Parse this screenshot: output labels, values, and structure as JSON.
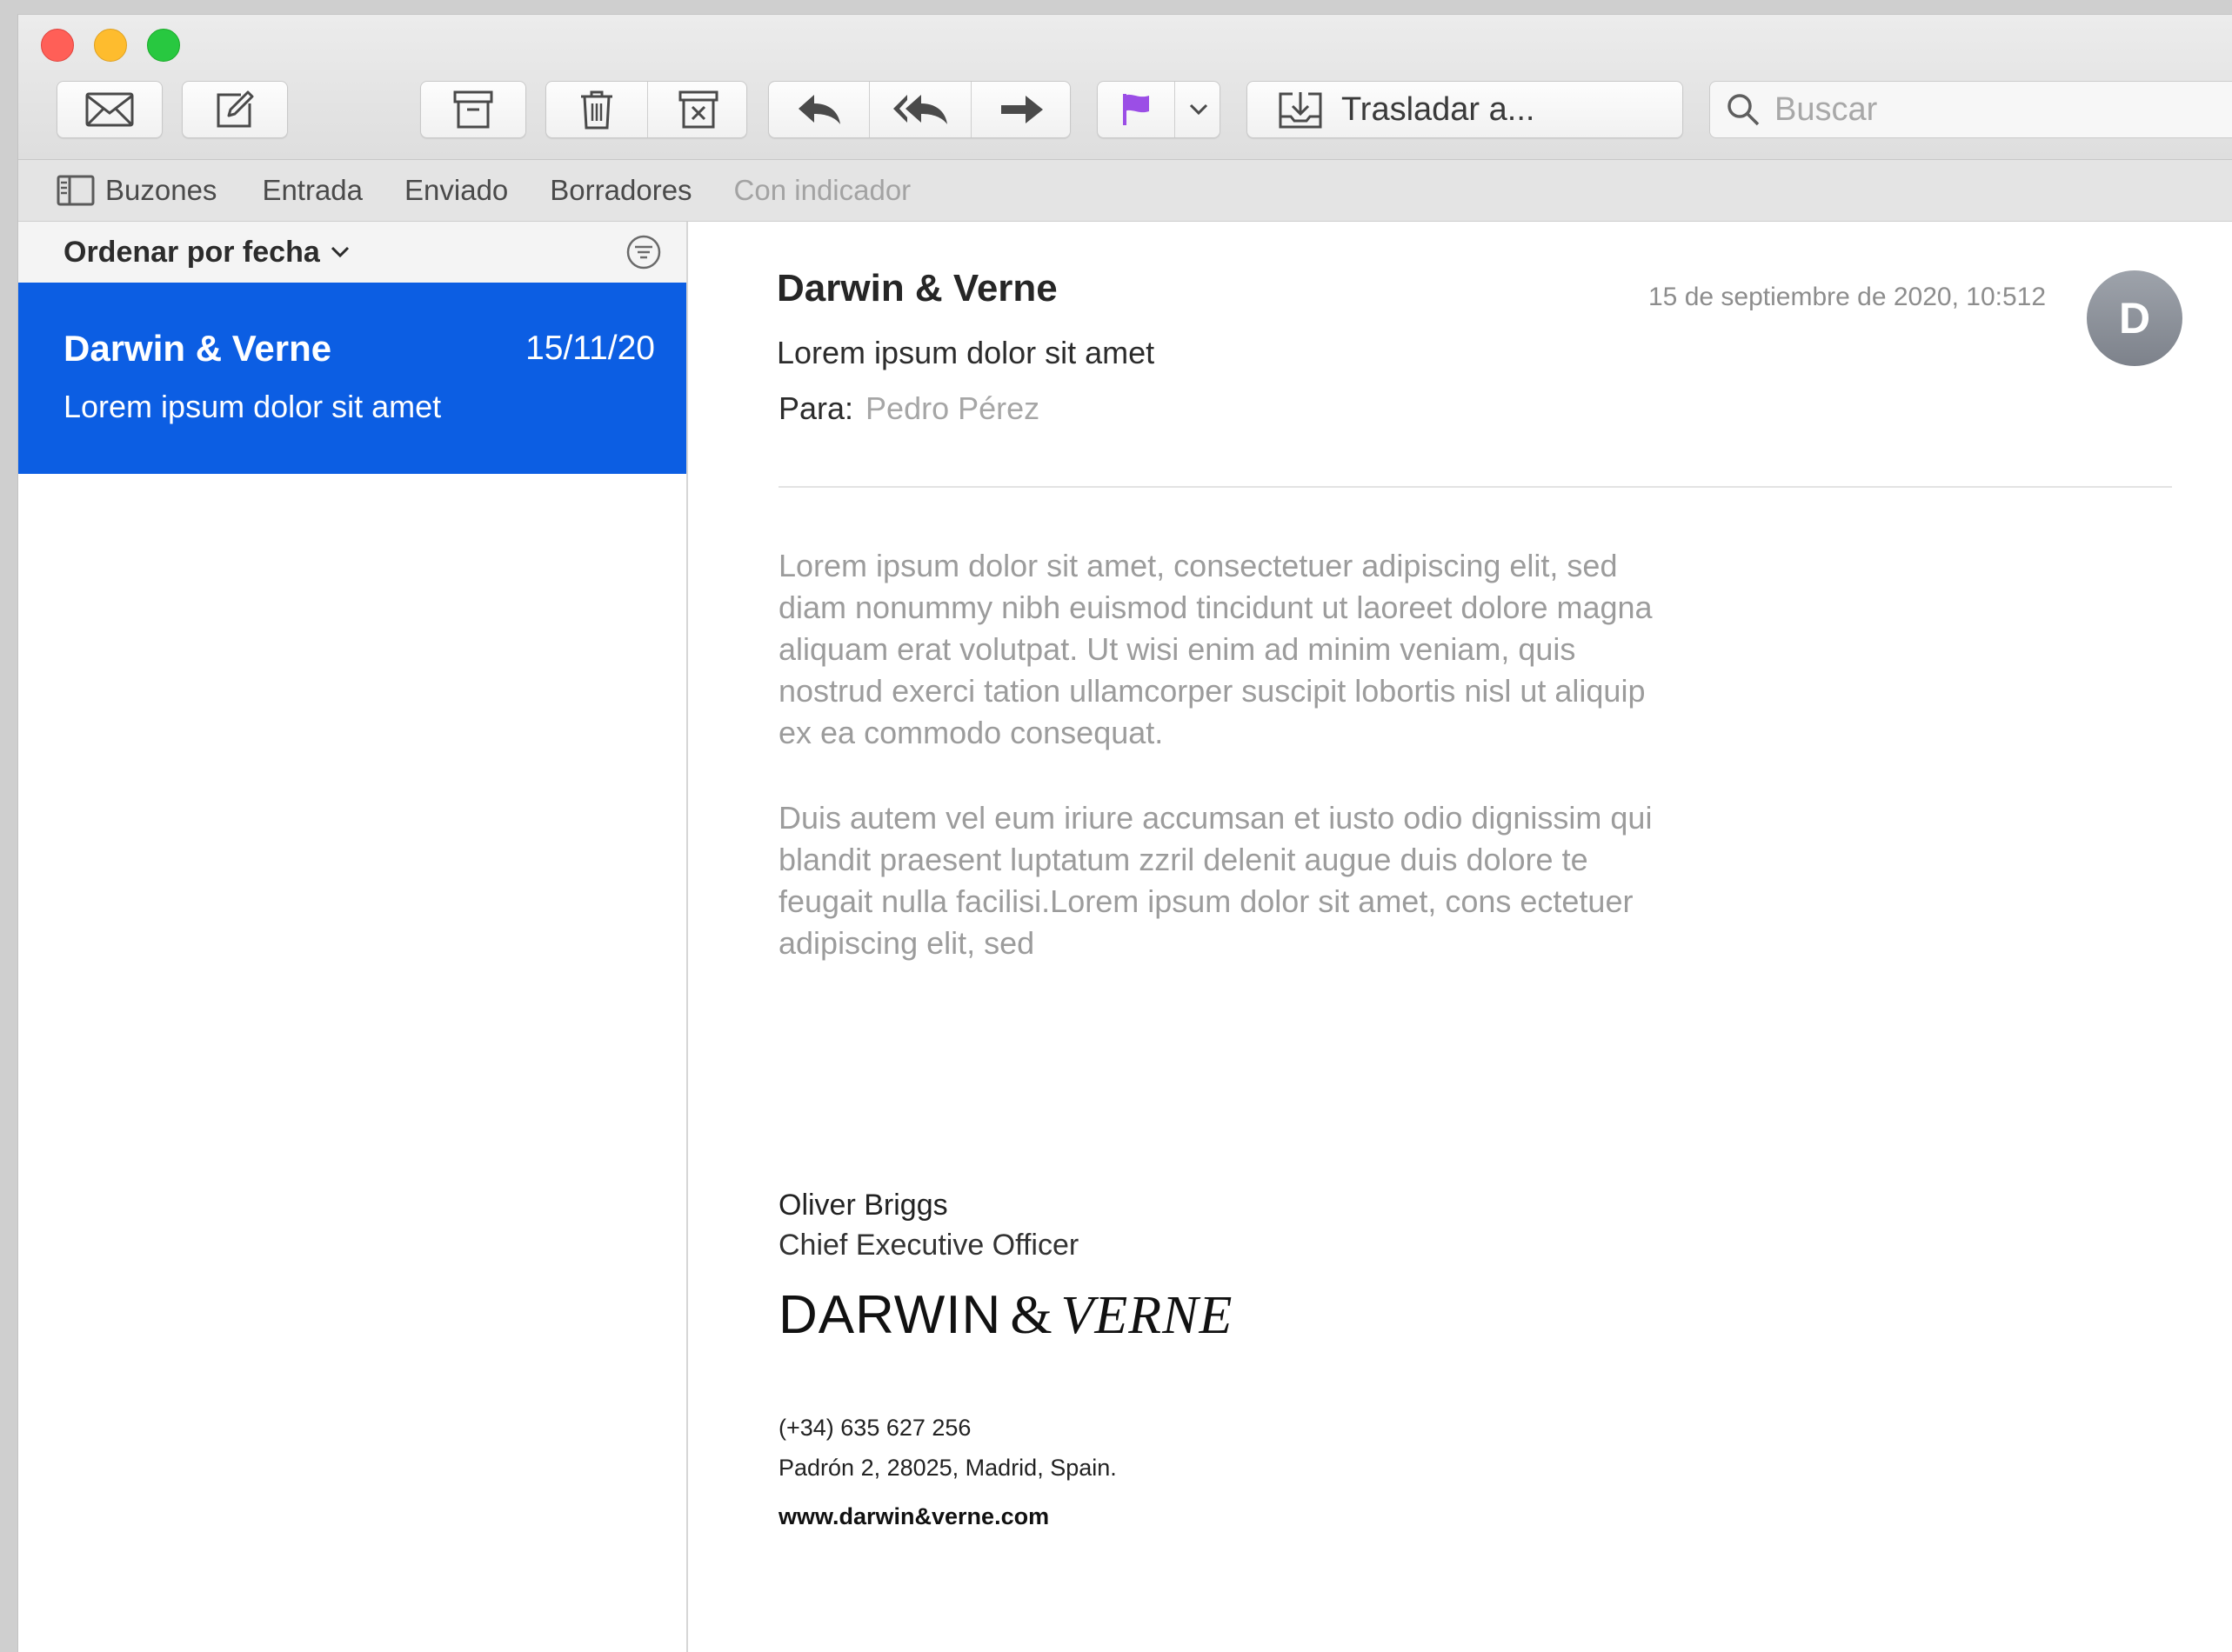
{
  "toolbar": {
    "move_label": "Trasladar a...",
    "search_placeholder": "Buscar",
    "flag_color": "#9b4ee6"
  },
  "favorites": {
    "items": [
      "Buzones",
      "Entrada",
      "Enviado",
      "Borradores",
      "Con indicador"
    ]
  },
  "list": {
    "sort_label": "Ordenar por fecha",
    "messages": [
      {
        "sender": "Darwin & Verne",
        "date": "15/11/20",
        "subject": "Lorem ipsum dolor sit amet",
        "selected": true
      }
    ],
    "selected_color": "#0c5ee3"
  },
  "message": {
    "sender": "Darwin & Verne",
    "date": "15 de septiembre de 2020, 10:512",
    "avatar_initial": "D",
    "subject": "Lorem ipsum dolor sit amet",
    "to_label": "Para:",
    "to_name": "Pedro Pérez",
    "body": [
      "Lorem ipsum dolor sit amet, consectetuer adipiscing elit, sed diam nonummy nibh euismod tincidunt ut laoreet dolore magna aliquam erat volutpat. Ut wisi enim ad minim veniam, quis nostrud exerci tation ullamcorper suscipit lobortis nisl ut aliquip ex ea commodo consequat.",
      "Duis autem vel eum iriure accumsan et iusto odio dignissim qui blandit praesent luptatum zzril delenit augue duis dolore te feugait nulla facilisi.Lorem ipsum dolor sit amet, cons ectetuer adipiscing elit, sed"
    ],
    "signature": {
      "name": "Oliver Briggs",
      "title": "Chief Executive Officer",
      "logo_part1": "DARWIN",
      "logo_amp": "&",
      "logo_part2": "VERNE",
      "phone": "(+34) 635 627 256",
      "address": "Padrón 2, 28025, Madrid, Spain.",
      "website": "www.darwin&verne.com"
    }
  }
}
